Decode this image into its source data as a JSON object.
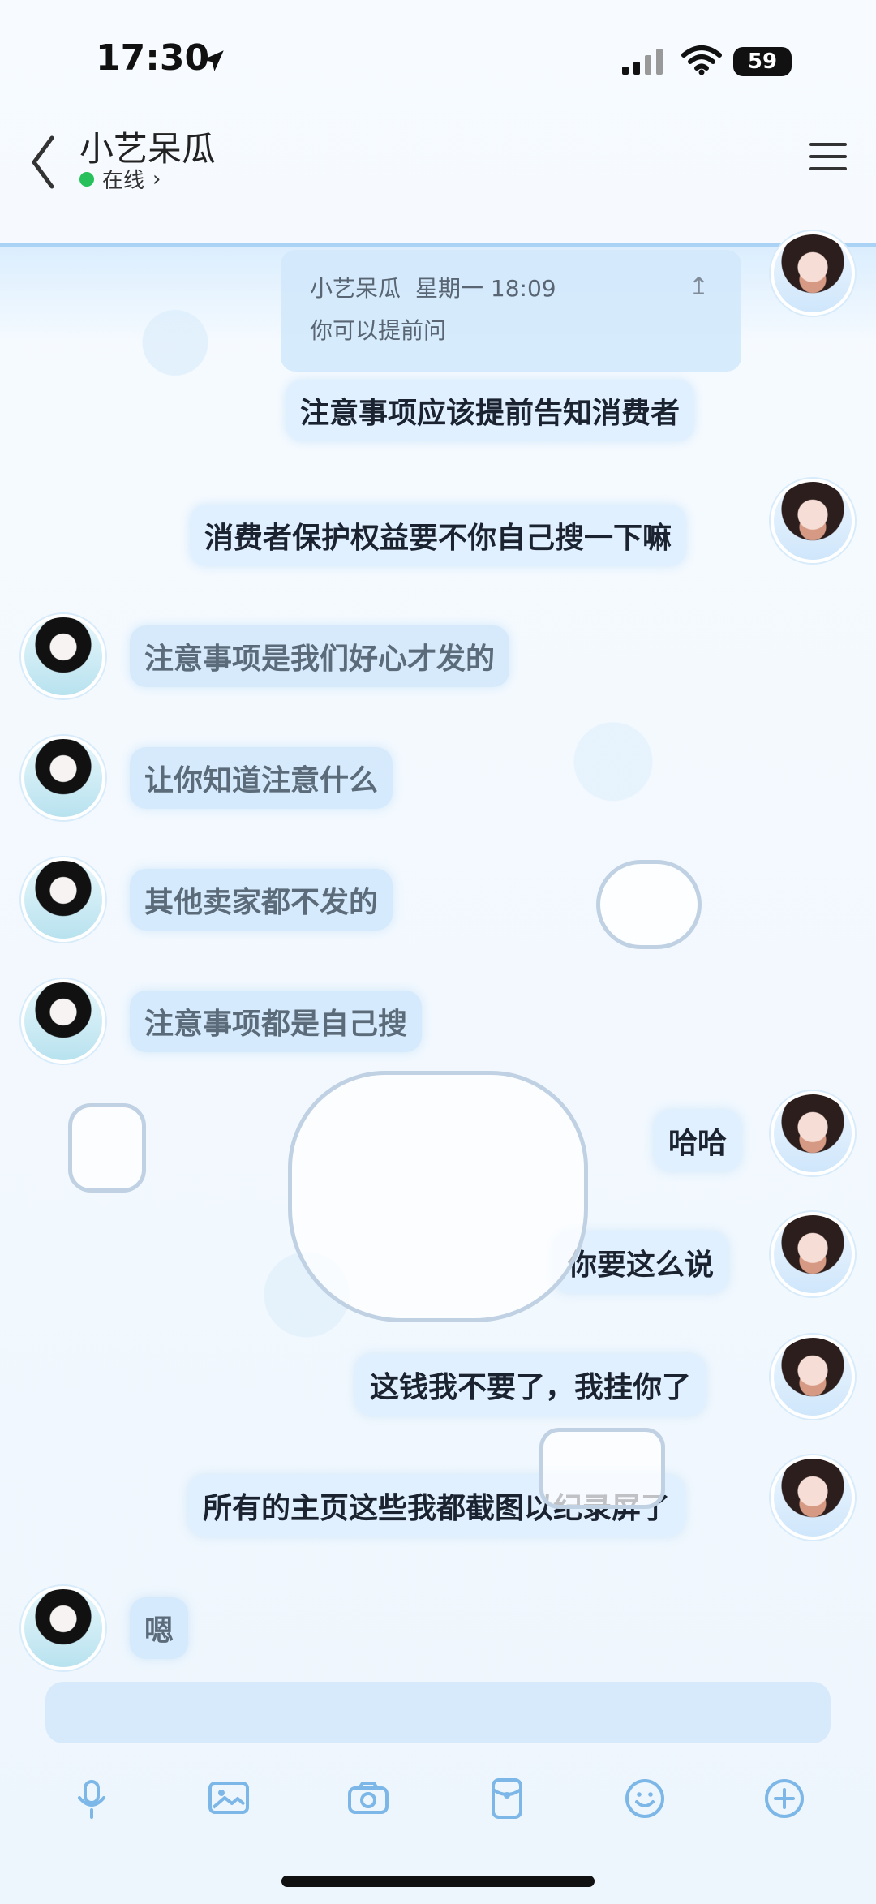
{
  "status": {
    "time": "17:30",
    "battery": "59"
  },
  "header": {
    "title": "小艺呆瓜",
    "presence": "在线"
  },
  "quote": {
    "sender": "小艺呆瓜",
    "time": "星期一 18:09",
    "text": "你可以提前问"
  },
  "messages": [
    {
      "side": "right",
      "text": "注意事项应该提前告知消费者"
    },
    {
      "side": "right",
      "text": "消费者保护权益要不你自己搜一下嘛"
    },
    {
      "side": "left",
      "text": "注意事项是我们好心才发的"
    },
    {
      "side": "left",
      "text": "让你知道注意什么"
    },
    {
      "side": "left",
      "text": "其他卖家都不发的"
    },
    {
      "side": "left",
      "text": "注意事项都是自己搜"
    },
    {
      "side": "right",
      "text": "哈哈"
    },
    {
      "side": "right",
      "text": "你要这么说"
    },
    {
      "side": "right",
      "text": "这钱我不要了，我挂你了"
    },
    {
      "side": "right",
      "text": "所有的主页这些我都截图以纪录屏了"
    },
    {
      "side": "left",
      "text": "嗯"
    }
  ],
  "icons": {
    "back": "chevron-left-icon",
    "menu": "menu-icon",
    "voice": "microphone-icon",
    "image": "image-icon",
    "camera": "camera-icon",
    "redpacket": "red-packet-icon",
    "emoji": "emoji-icon",
    "plus": "plus-icon"
  }
}
